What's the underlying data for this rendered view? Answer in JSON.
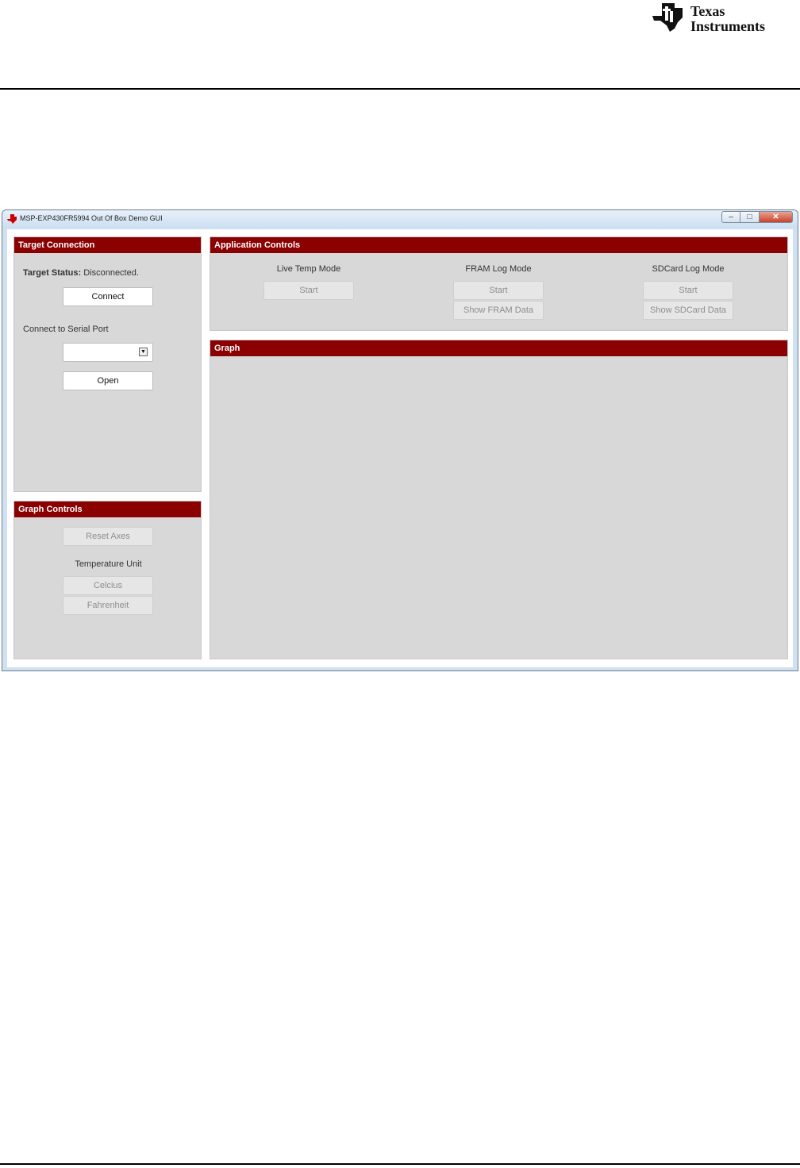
{
  "doc": {
    "logo_line1": "Texas",
    "logo_line2": "Instruments"
  },
  "window": {
    "title": "MSP-EXP430FR5994 Out Of Box Demo GUI",
    "minimize_glyph": "–",
    "maximize_glyph": "□",
    "close_glyph": "✕"
  },
  "target_connection": {
    "header": "Target Connection",
    "status_label": "Target Status:",
    "status_value": "Disconnected.",
    "connect_button": "Connect",
    "serial_port_label": "Connect to Serial Port",
    "serial_port_value": "",
    "open_button": "Open"
  },
  "graph_controls": {
    "header": "Graph Controls",
    "reset_axes_button": "Reset Axes",
    "temperature_unit_label": "Temperature Unit",
    "celcius_button": "Celcius",
    "fahrenheit_button": "Fahrenheit"
  },
  "application_controls": {
    "header": "Application Controls",
    "live_temp": {
      "label": "Live Temp Mode",
      "start": "Start"
    },
    "fram_log": {
      "label": "FRAM Log Mode",
      "start": "Start",
      "show": "Show FRAM Data"
    },
    "sdcard_log": {
      "label": "SDCard Log Mode",
      "start": "Start",
      "show": "Show SDCard Data"
    }
  },
  "graph": {
    "header": "Graph"
  },
  "colors": {
    "panel_header": "#8b0000",
    "panel_bg": "#d8d8d8",
    "ti_red": "#cc0000"
  },
  "icons": [
    "ti-logo-icon",
    "app-icon",
    "minimize-icon",
    "maximize-icon",
    "close-icon",
    "chevron-down-icon"
  ]
}
